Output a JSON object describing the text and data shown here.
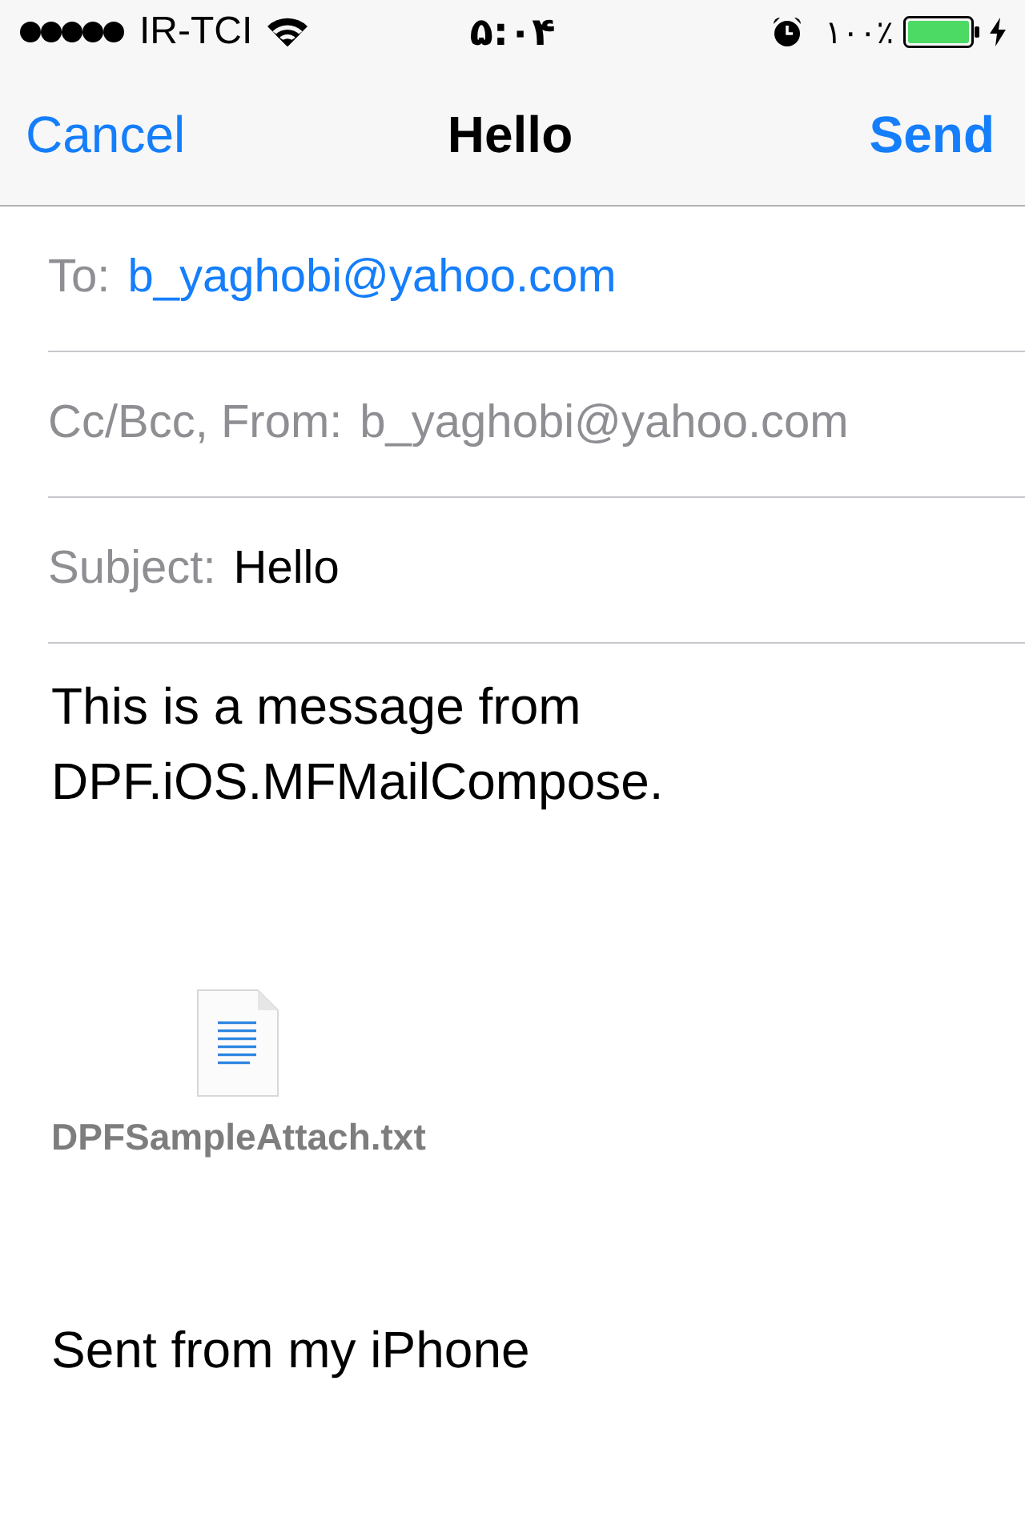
{
  "status_bar": {
    "carrier": "IR-TCI",
    "time": "۵:۰۴",
    "battery": "۱۰۰٪"
  },
  "nav_bar": {
    "cancel": "Cancel",
    "title": "Hello",
    "send": "Send"
  },
  "fields": [
    {
      "kind": "to",
      "label": "To:",
      "value": "b_yaghobi@yahoo.com"
    },
    {
      "kind": "from",
      "label": "Cc/Bcc, From:",
      "value": "b_yaghobi@yahoo.com"
    },
    {
      "kind": "subject",
      "label": "Subject:",
      "value": "Hello"
    }
  ],
  "body": {
    "message": "This is a message from DPF.iOS.MFMailCompose.",
    "attachment": {
      "name": "DPFSampleAttach.txt"
    },
    "signature": "Sent from my iPhone"
  }
}
